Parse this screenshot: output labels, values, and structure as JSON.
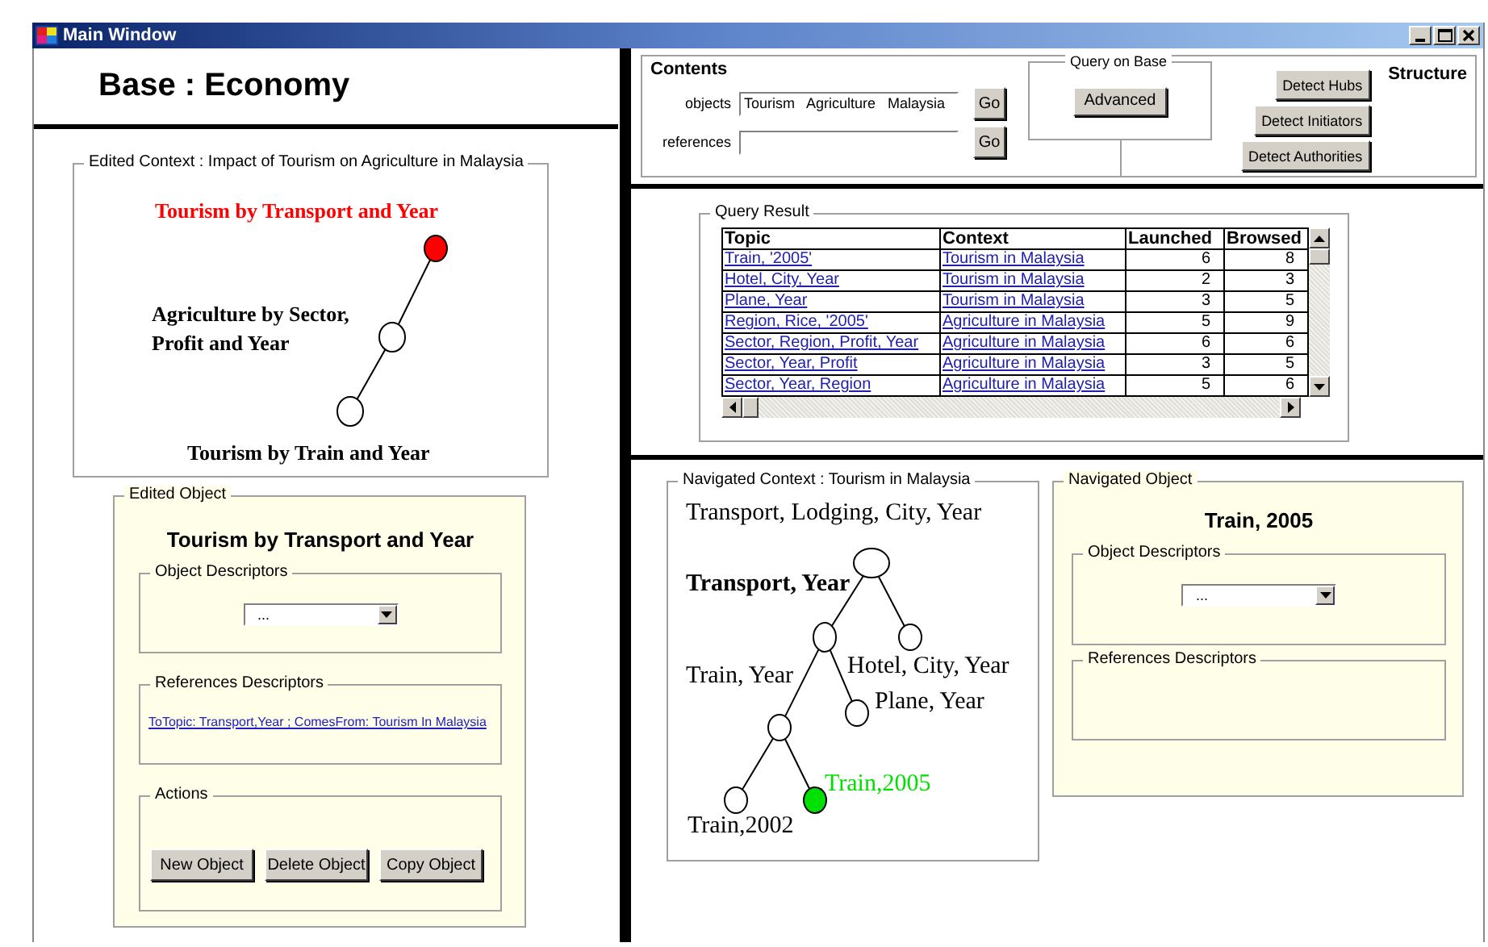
{
  "window": {
    "title": "Main Window"
  },
  "base": {
    "label": "Base : Economy"
  },
  "edited_context": {
    "title": "Edited Context : Impact of Tourism on Agriculture in Malaysia",
    "tree": {
      "label": "Tourism by Transport and Year",
      "selected": true,
      "color": "#ff0000",
      "bold": true,
      "children": [
        {
          "label": "Agriculture by Sector, Profit and Year",
          "selected": false,
          "bold": true,
          "children": [
            {
              "label": "Tourism by Train and Year",
              "selected": false,
              "bold": true
            }
          ]
        }
      ]
    }
  },
  "edited_object": {
    "title": "Edited Object",
    "name": "Tourism by Transport and Year",
    "object_descriptors": {
      "title": "Object Descriptors",
      "value": "..."
    },
    "references_descriptors": {
      "title": "References Descriptors",
      "links": [
        "ToTopic: Transport,Year ; ComesFrom: Tourism In Malaysia"
      ]
    },
    "actions": {
      "title": "Actions",
      "buttons": [
        "New Object",
        "Delete Object",
        "Copy Object"
      ]
    }
  },
  "contents": {
    "title": "Contents",
    "fields": [
      {
        "label": "objects",
        "value": "Tourism   Agriculture   Malaysia",
        "button": "Go"
      },
      {
        "label": "references",
        "button": "Go"
      }
    ]
  },
  "query_on_base": {
    "title": "Query on  Base",
    "button": "Advanced"
  },
  "structure": {
    "title": "Structure",
    "buttons": [
      "Detect Hubs",
      "Detect  Initiators",
      "Detect Authorities"
    ]
  },
  "query_result": {
    "title": "Query Result",
    "columns": [
      "Topic",
      "Context",
      "Launched",
      "Browsed"
    ],
    "rows": [
      [
        "Train, '2005'",
        "Tourism in Malaysia",
        "6",
        "8"
      ],
      [
        "Hotel, City, Year",
        "Tourism in Malaysia",
        "2",
        "3"
      ],
      [
        "Plane, Year",
        "Tourism in Malaysia",
        "3",
        "5"
      ],
      [
        "Region, Rice, '2005'",
        "Agriculture in Malaysia",
        "5",
        "9"
      ],
      [
        "Sector, Region, Profit, Year",
        "Agriculture in Malaysia",
        "6",
        "6"
      ],
      [
        "Sector, Year, Profit",
        "Agriculture in Malaysia",
        "3",
        "5"
      ],
      [
        "Sector, Year, Region",
        "Agriculture in Malaysia",
        "5",
        "6"
      ]
    ]
  },
  "navigated_context": {
    "title": "Navigated Context : Tourism in Malaysia",
    "tree": {
      "label": "Transport, Lodging, City, Year",
      "selected": false,
      "bold": false,
      "children": [
        {
          "label": "Transport, Year",
          "selected": false,
          "bold": true,
          "children": [
            {
              "label": "Train, Year",
              "selected": false,
              "bold": false,
              "children": [
                {
                  "label": "Train,2002",
                  "selected": false,
                  "bold": false
                },
                {
                  "label": "Train,2005",
                  "selected": true,
                  "color": "#00e000",
                  "bold": false
                }
              ]
            },
            {
              "label": "Plane, Year",
              "selected": false,
              "bold": false
            }
          ]
        },
        {
          "label": "Hotel, City, Year",
          "selected": false,
          "bold": false
        }
      ]
    }
  },
  "navigated_object": {
    "title": "Navigated Object",
    "name": "Train, 2005",
    "object_descriptors": {
      "title": "Object Descriptors",
      "value": "..."
    },
    "references_descriptors": {
      "title": "References Descriptors"
    }
  }
}
